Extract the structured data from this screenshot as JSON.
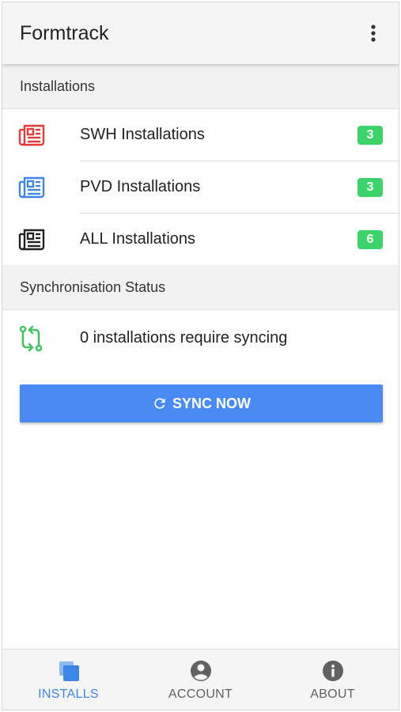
{
  "app": {
    "title": "Formtrack"
  },
  "sections": {
    "installations": {
      "header": "Installations",
      "items": [
        {
          "label": "SWH Installations",
          "count": "3",
          "icon": "form-icon",
          "icon_color": "#e53935"
        },
        {
          "label": "PVD Installations",
          "count": "3",
          "icon": "form-icon",
          "icon_color": "#3d86e8"
        },
        {
          "label": "ALL Installations",
          "count": "6",
          "icon": "form-icon",
          "icon_color": "#212121"
        }
      ]
    },
    "sync": {
      "header": "Synchronisation Status",
      "status_text": "0 installations require syncing",
      "icon": "sync-arrows-icon",
      "icon_color": "#43c463",
      "button_label": "SYNC NOW"
    }
  },
  "bottom_nav": {
    "items": [
      {
        "label": "INSTALLS",
        "icon": "stack-icon",
        "active": true
      },
      {
        "label": "ACCOUNT",
        "icon": "account-circle-icon",
        "active": false
      },
      {
        "label": "ABOUT",
        "icon": "info-icon",
        "active": false
      }
    ]
  },
  "colors": {
    "accent": "#4a8af4",
    "badge": "#3cd46a",
    "nav_active": "#3d86e8",
    "nav_inactive": "#616161"
  }
}
